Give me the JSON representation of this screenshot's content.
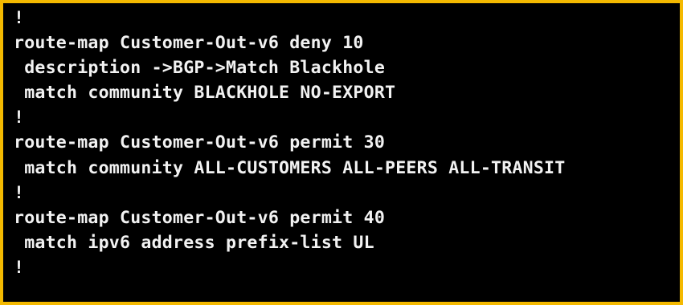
{
  "terminal": {
    "lines": [
      "!",
      "route-map Customer-Out-v6 deny 10",
      " description ->BGP->Match Blackhole",
      " match community BLACKHOLE NO-EXPORT",
      "!",
      "route-map Customer-Out-v6 permit 30",
      " match community ALL-CUSTOMERS ALL-PEERS ALL-TRANSIT",
      "!",
      "route-map Customer-Out-v6 permit 40",
      " match ipv6 address prefix-list UL",
      "!"
    ]
  },
  "colors": {
    "frame": "#f4b900",
    "background": "#000000",
    "text": "#f2f2f2"
  }
}
